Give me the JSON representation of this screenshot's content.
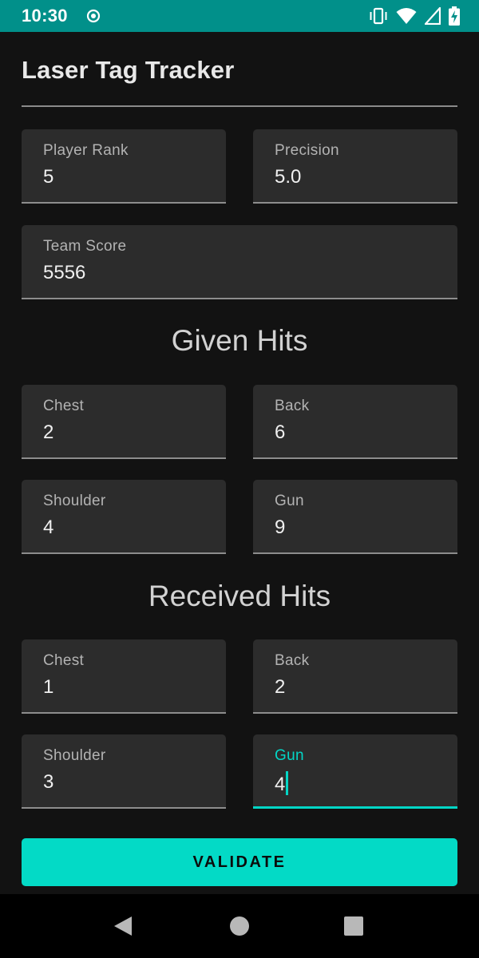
{
  "status_bar": {
    "time": "10:30",
    "icons": [
      "record-icon",
      "vibrate-icon",
      "wifi-icon",
      "signal-icon",
      "battery-charging-icon"
    ]
  },
  "app": {
    "title": "Laser Tag Tracker"
  },
  "stats": {
    "player_rank": {
      "label": "Player Rank",
      "value": "5"
    },
    "precision": {
      "label": "Precision",
      "value": "5.0"
    },
    "team_score": {
      "label": "Team Score",
      "value": "5556"
    }
  },
  "given_hits": {
    "heading": "Given Hits",
    "chest": {
      "label": "Chest",
      "value": "2"
    },
    "back": {
      "label": "Back",
      "value": "6"
    },
    "shoulder": {
      "label": "Shoulder",
      "value": "4"
    },
    "gun": {
      "label": "Gun",
      "value": "9"
    }
  },
  "received_hits": {
    "heading": "Received Hits",
    "chest": {
      "label": "Chest",
      "value": "1"
    },
    "back": {
      "label": "Back",
      "value": "2"
    },
    "shoulder": {
      "label": "Shoulder",
      "value": "3"
    },
    "gun": {
      "label": "Gun",
      "value": "4"
    }
  },
  "actions": {
    "validate_label": "VALIDATE"
  },
  "nav_bar": {
    "icons": [
      "back-icon",
      "home-icon",
      "recents-icon"
    ]
  },
  "colors": {
    "status_bar": "#01908a",
    "background": "#121212",
    "field_background": "#2c2c2c",
    "accent": "#03dac6"
  }
}
